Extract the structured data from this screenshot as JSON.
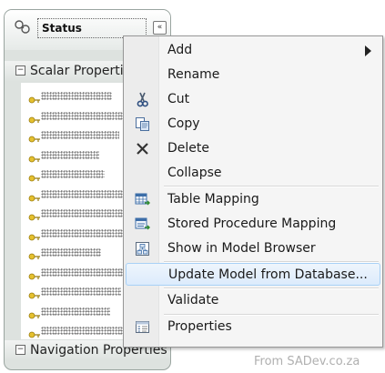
{
  "entity": {
    "title": "Status",
    "collapse_glyph": "«",
    "scalar_section": {
      "toggle": "−",
      "label": "Scalar Properties"
    },
    "navigation_section": {
      "toggle": "−",
      "label": "Navigation Properties"
    },
    "property_count": 13
  },
  "context_menu": {
    "items": [
      {
        "label": "Add",
        "icon": "",
        "submenu": true
      },
      {
        "label": "Rename",
        "icon": ""
      },
      {
        "label": "Cut",
        "icon": "cut-icon"
      },
      {
        "label": "Copy",
        "icon": "copy-icon"
      },
      {
        "label": "Delete",
        "icon": "delete-icon"
      },
      {
        "label": "Collapse",
        "icon": ""
      },
      {
        "label": "Table Mapping",
        "icon": "table-mapping-icon"
      },
      {
        "label": "Stored Procedure Mapping",
        "icon": "stored-procedure-mapping-icon"
      },
      {
        "label": "Show in Model Browser",
        "icon": "model-browser-icon"
      },
      {
        "label": "Update Model from Database...",
        "icon": "",
        "highlighted": true
      },
      {
        "label": "Validate",
        "icon": ""
      },
      {
        "label": "Properties",
        "icon": "properties-icon"
      }
    ]
  },
  "credit": "From SADev.co.za",
  "colors": {
    "menu_background": "#f5f5f5",
    "highlight_border": "#a8d1f6",
    "entity_background": "#dde2df"
  }
}
